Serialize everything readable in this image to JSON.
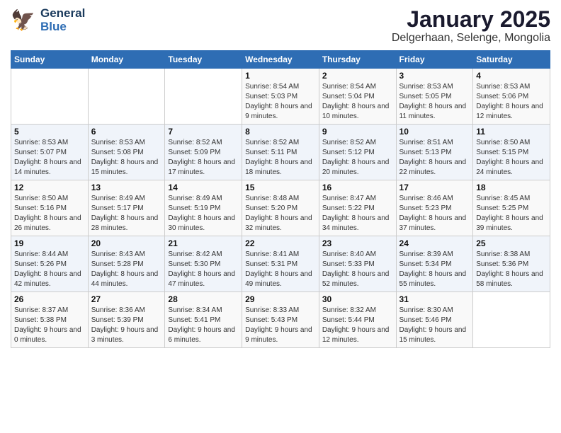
{
  "logo": {
    "line1": "General",
    "line2": "Blue"
  },
  "title": "January 2025",
  "subtitle": "Delgerhaan, Selenge, Mongolia",
  "headers": [
    "Sunday",
    "Monday",
    "Tuesday",
    "Wednesday",
    "Thursday",
    "Friday",
    "Saturday"
  ],
  "weeks": [
    [
      {
        "day": "",
        "sunrise": "",
        "sunset": "",
        "daylight": ""
      },
      {
        "day": "",
        "sunrise": "",
        "sunset": "",
        "daylight": ""
      },
      {
        "day": "",
        "sunrise": "",
        "sunset": "",
        "daylight": ""
      },
      {
        "day": "1",
        "sunrise": "Sunrise: 8:54 AM",
        "sunset": "Sunset: 5:03 PM",
        "daylight": "Daylight: 8 hours and 9 minutes."
      },
      {
        "day": "2",
        "sunrise": "Sunrise: 8:54 AM",
        "sunset": "Sunset: 5:04 PM",
        "daylight": "Daylight: 8 hours and 10 minutes."
      },
      {
        "day": "3",
        "sunrise": "Sunrise: 8:53 AM",
        "sunset": "Sunset: 5:05 PM",
        "daylight": "Daylight: 8 hours and 11 minutes."
      },
      {
        "day": "4",
        "sunrise": "Sunrise: 8:53 AM",
        "sunset": "Sunset: 5:06 PM",
        "daylight": "Daylight: 8 hours and 12 minutes."
      }
    ],
    [
      {
        "day": "5",
        "sunrise": "Sunrise: 8:53 AM",
        "sunset": "Sunset: 5:07 PM",
        "daylight": "Daylight: 8 hours and 14 minutes."
      },
      {
        "day": "6",
        "sunrise": "Sunrise: 8:53 AM",
        "sunset": "Sunset: 5:08 PM",
        "daylight": "Daylight: 8 hours and 15 minutes."
      },
      {
        "day": "7",
        "sunrise": "Sunrise: 8:52 AM",
        "sunset": "Sunset: 5:09 PM",
        "daylight": "Daylight: 8 hours and 17 minutes."
      },
      {
        "day": "8",
        "sunrise": "Sunrise: 8:52 AM",
        "sunset": "Sunset: 5:11 PM",
        "daylight": "Daylight: 8 hours and 18 minutes."
      },
      {
        "day": "9",
        "sunrise": "Sunrise: 8:52 AM",
        "sunset": "Sunset: 5:12 PM",
        "daylight": "Daylight: 8 hours and 20 minutes."
      },
      {
        "day": "10",
        "sunrise": "Sunrise: 8:51 AM",
        "sunset": "Sunset: 5:13 PM",
        "daylight": "Daylight: 8 hours and 22 minutes."
      },
      {
        "day": "11",
        "sunrise": "Sunrise: 8:50 AM",
        "sunset": "Sunset: 5:15 PM",
        "daylight": "Daylight: 8 hours and 24 minutes."
      }
    ],
    [
      {
        "day": "12",
        "sunrise": "Sunrise: 8:50 AM",
        "sunset": "Sunset: 5:16 PM",
        "daylight": "Daylight: 8 hours and 26 minutes."
      },
      {
        "day": "13",
        "sunrise": "Sunrise: 8:49 AM",
        "sunset": "Sunset: 5:17 PM",
        "daylight": "Daylight: 8 hours and 28 minutes."
      },
      {
        "day": "14",
        "sunrise": "Sunrise: 8:49 AM",
        "sunset": "Sunset: 5:19 PM",
        "daylight": "Daylight: 8 hours and 30 minutes."
      },
      {
        "day": "15",
        "sunrise": "Sunrise: 8:48 AM",
        "sunset": "Sunset: 5:20 PM",
        "daylight": "Daylight: 8 hours and 32 minutes."
      },
      {
        "day": "16",
        "sunrise": "Sunrise: 8:47 AM",
        "sunset": "Sunset: 5:22 PM",
        "daylight": "Daylight: 8 hours and 34 minutes."
      },
      {
        "day": "17",
        "sunrise": "Sunrise: 8:46 AM",
        "sunset": "Sunset: 5:23 PM",
        "daylight": "Daylight: 8 hours and 37 minutes."
      },
      {
        "day": "18",
        "sunrise": "Sunrise: 8:45 AM",
        "sunset": "Sunset: 5:25 PM",
        "daylight": "Daylight: 8 hours and 39 minutes."
      }
    ],
    [
      {
        "day": "19",
        "sunrise": "Sunrise: 8:44 AM",
        "sunset": "Sunset: 5:26 PM",
        "daylight": "Daylight: 8 hours and 42 minutes."
      },
      {
        "day": "20",
        "sunrise": "Sunrise: 8:43 AM",
        "sunset": "Sunset: 5:28 PM",
        "daylight": "Daylight: 8 hours and 44 minutes."
      },
      {
        "day": "21",
        "sunrise": "Sunrise: 8:42 AM",
        "sunset": "Sunset: 5:30 PM",
        "daylight": "Daylight: 8 hours and 47 minutes."
      },
      {
        "day": "22",
        "sunrise": "Sunrise: 8:41 AM",
        "sunset": "Sunset: 5:31 PM",
        "daylight": "Daylight: 8 hours and 49 minutes."
      },
      {
        "day": "23",
        "sunrise": "Sunrise: 8:40 AM",
        "sunset": "Sunset: 5:33 PM",
        "daylight": "Daylight: 8 hours and 52 minutes."
      },
      {
        "day": "24",
        "sunrise": "Sunrise: 8:39 AM",
        "sunset": "Sunset: 5:34 PM",
        "daylight": "Daylight: 8 hours and 55 minutes."
      },
      {
        "day": "25",
        "sunrise": "Sunrise: 8:38 AM",
        "sunset": "Sunset: 5:36 PM",
        "daylight": "Daylight: 8 hours and 58 minutes."
      }
    ],
    [
      {
        "day": "26",
        "sunrise": "Sunrise: 8:37 AM",
        "sunset": "Sunset: 5:38 PM",
        "daylight": "Daylight: 9 hours and 0 minutes."
      },
      {
        "day": "27",
        "sunrise": "Sunrise: 8:36 AM",
        "sunset": "Sunset: 5:39 PM",
        "daylight": "Daylight: 9 hours and 3 minutes."
      },
      {
        "day": "28",
        "sunrise": "Sunrise: 8:34 AM",
        "sunset": "Sunset: 5:41 PM",
        "daylight": "Daylight: 9 hours and 6 minutes."
      },
      {
        "day": "29",
        "sunrise": "Sunrise: 8:33 AM",
        "sunset": "Sunset: 5:43 PM",
        "daylight": "Daylight: 9 hours and 9 minutes."
      },
      {
        "day": "30",
        "sunrise": "Sunrise: 8:32 AM",
        "sunset": "Sunset: 5:44 PM",
        "daylight": "Daylight: 9 hours and 12 minutes."
      },
      {
        "day": "31",
        "sunrise": "Sunrise: 8:30 AM",
        "sunset": "Sunset: 5:46 PM",
        "daylight": "Daylight: 9 hours and 15 minutes."
      },
      {
        "day": "",
        "sunrise": "",
        "sunset": "",
        "daylight": ""
      }
    ]
  ]
}
